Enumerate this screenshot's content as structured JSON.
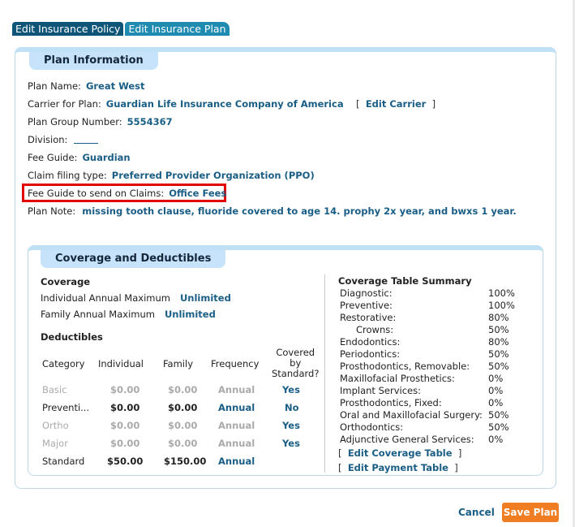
{
  "tabs": [
    "Edit Insurance Policy",
    "Edit Insurance Plan"
  ],
  "plan_info": {
    "title": "Plan Information",
    "plan_name_label": "Plan Name:",
    "plan_name": "Great West",
    "carrier_label": "Carrier for Plan:",
    "carrier": "Guardian Life Insurance Company of America",
    "edit_carrier": "Edit Carrier",
    "group_number_label": "Plan Group Number:",
    "group_number": "5554367",
    "division_label": "Division:",
    "fee_guide_label": "Fee Guide:",
    "fee_guide": "Guardian",
    "claim_type_label": "Claim filing type:",
    "claim_type": "Preferred Provider Organization (PPO)",
    "fee_guide_claims_label": "Fee Guide to send on Claims:",
    "fee_guide_claims": "Office Fees",
    "plan_note_label": "Plan Note:",
    "plan_note": "missing tooth clause, fluoride covered to age 14. prophy 2x year, and bwxs 1 year."
  },
  "coverage": {
    "title": "Coverage and Deductibles",
    "coverage_heading": "Coverage",
    "individual_max_label": "Individual Annual Maximum",
    "individual_max": "Unlimited",
    "family_max_label": "Family Annual Maximum",
    "family_max": "Unlimited",
    "deductibles_heading": "Deductibles",
    "headers": [
      "Category",
      "Individual",
      "Family",
      "Frequency",
      "Covered",
      "by",
      "Standard?"
    ],
    "rows": [
      {
        "category": "Basic",
        "individual": "$0.00",
        "family": "$0.00",
        "frequency": "Annual",
        "covered": "Yes"
      },
      {
        "category": "Preventi...",
        "individual": "$0.00",
        "family": "$0.00",
        "frequency": "Annual",
        "covered": "No"
      },
      {
        "category": "Ortho",
        "individual": "$0.00",
        "family": "$0.00",
        "frequency": "Annual",
        "covered": "Yes"
      },
      {
        "category": "Major",
        "individual": "$0.00",
        "family": "$0.00",
        "frequency": "Annual",
        "covered": "Yes"
      },
      {
        "category": "Standard",
        "individual": "$50.00",
        "family": "$150.00",
        "frequency": "Annual",
        "covered": ""
      }
    ]
  },
  "summary": {
    "title": "Coverage Table Summary",
    "items": [
      {
        "label": "Diagnostic:",
        "value": "100%"
      },
      {
        "label": "Preventive:",
        "value": "100%"
      },
      {
        "label": "Restorative:",
        "value": "80%"
      },
      {
        "label": "Crowns:",
        "value": "50%"
      },
      {
        "label": "Endodontics:",
        "value": "80%"
      },
      {
        "label": "Periodontics:",
        "value": "50%"
      },
      {
        "label": "Prosthodontics, Removable:",
        "value": "50%"
      },
      {
        "label": "Maxillofacial Prosthetics:",
        "value": "0%"
      },
      {
        "label": "Implant Services:",
        "value": "0%"
      },
      {
        "label": "Prosthodontics, Fixed:",
        "value": "0%"
      },
      {
        "label": "Oral and Maxillofacial Surgery:",
        "value": "50%"
      },
      {
        "label": "Orthodontics:",
        "value": "50%"
      },
      {
        "label": "Adjunctive General Services:",
        "value": "0%"
      }
    ],
    "edit_coverage": "Edit Coverage Table",
    "edit_payment": "Edit Payment Table"
  },
  "footer": {
    "cancel": "Cancel",
    "save": "Save Plan"
  }
}
